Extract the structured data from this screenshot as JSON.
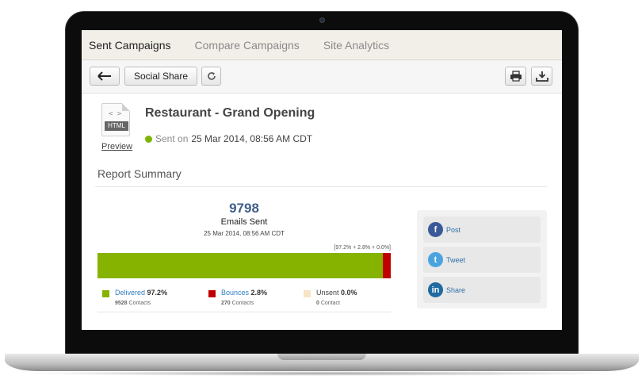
{
  "tabs": [
    {
      "label": "Sent Campaigns",
      "active": true
    },
    {
      "label": "Compare Campaigns",
      "active": false
    },
    {
      "label": "Site Analytics",
      "active": false
    }
  ],
  "toolbar": {
    "back_icon": "arrow-left-icon",
    "social_share_label": "Social Share",
    "refresh_icon": "refresh-icon",
    "print_icon": "printer-icon",
    "download_icon": "download-icon"
  },
  "campaign": {
    "file_tag": "HTML",
    "file_code": "< >",
    "preview_label": "Preview",
    "title": "Restaurant - Grand Opening",
    "status_label": "Sent on",
    "sent_date": "25 Mar 2014, 08:56 AM CDT"
  },
  "report": {
    "section_title": "Report Summary",
    "total": "9798",
    "total_label": "Emails Sent",
    "total_date": "25 Mar 2014, 08:56 AM CDT",
    "pct_summary": "[97.2% + 2.8% + 0.0%]",
    "segments": [
      {
        "label": "Delivered",
        "pct_text": "97.2%",
        "pct": 97.2,
        "contacts": "9528",
        "contacts_label": "Contacts",
        "color": "#86b300"
      },
      {
        "label": "Bounces",
        "pct_text": "2.8%",
        "pct": 2.8,
        "contacts": "270",
        "contacts_label": "Contacts",
        "color": "#c00000"
      },
      {
        "label": "Unsent",
        "pct_text": "0.0%",
        "pct": 0.0,
        "contacts": "0",
        "contacts_label": "Contact",
        "color": "#f6e5c4"
      }
    ]
  },
  "share": [
    {
      "label": "Post",
      "icon": "facebook-icon",
      "glyph": "f",
      "color": "#3b5998"
    },
    {
      "label": "Tweet",
      "icon": "twitter-icon",
      "glyph": "t",
      "color": "#4aa3df"
    },
    {
      "label": "Share",
      "icon": "linkedin-icon",
      "glyph": "in",
      "color": "#1f6aa0"
    }
  ],
  "colors": {
    "accent_blue": "#3f5f8a",
    "status_green": "#7cb400"
  }
}
